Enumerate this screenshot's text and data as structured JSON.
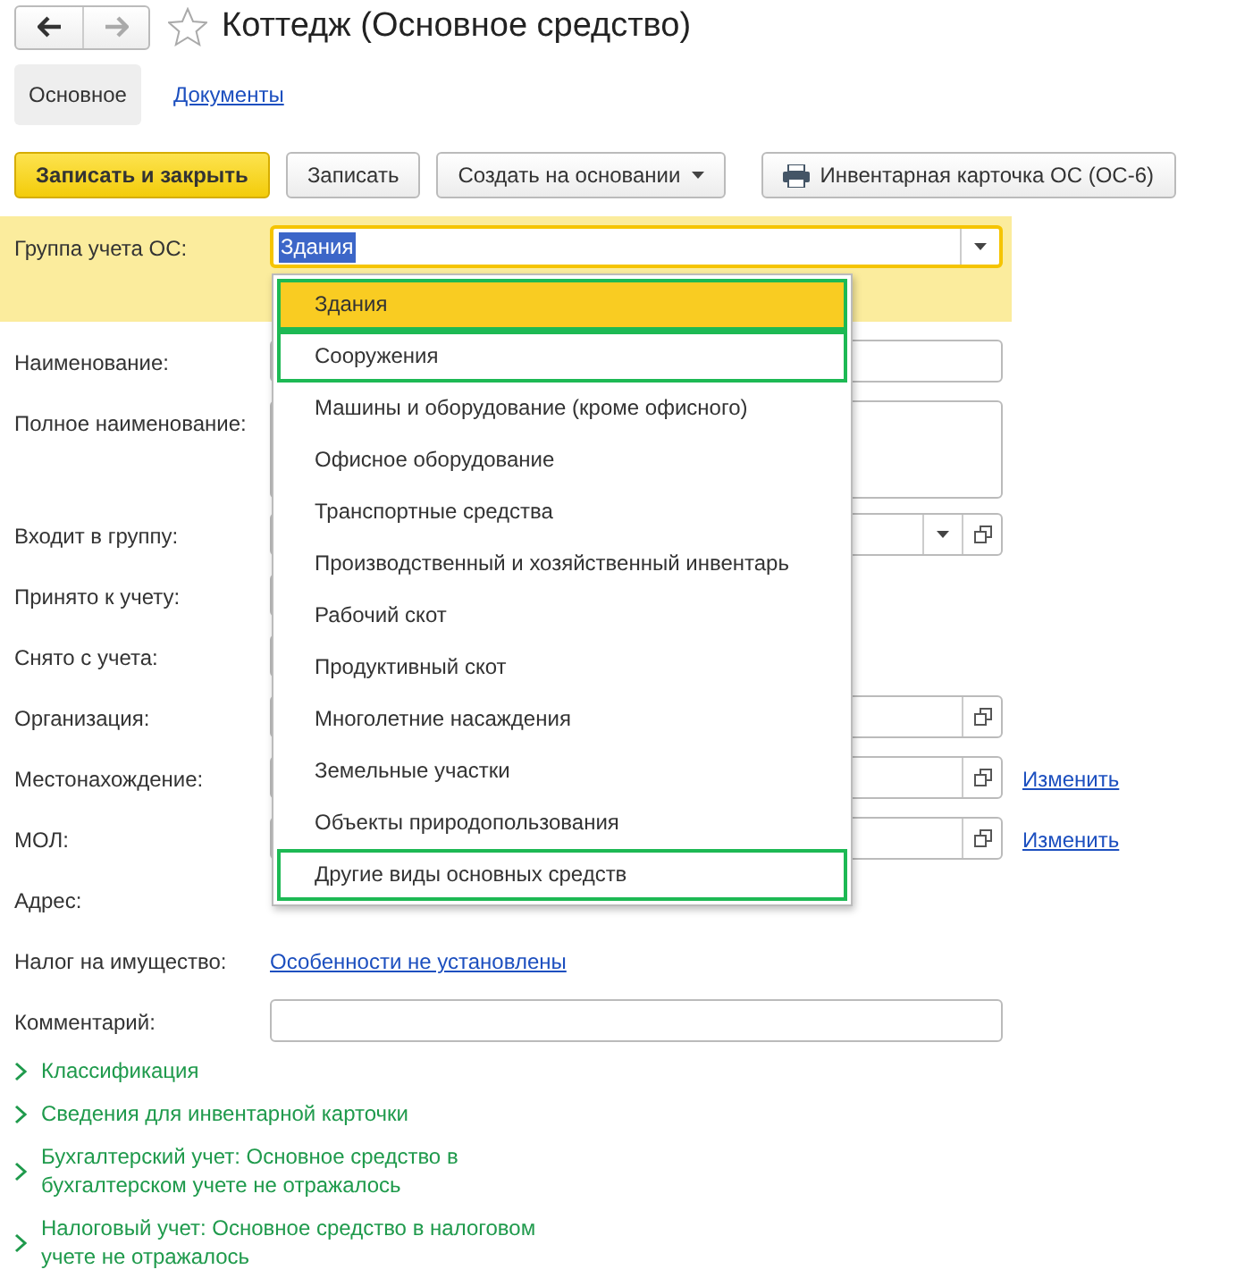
{
  "window": {
    "title": "Коттедж (Основное средство)",
    "favorite": false
  },
  "tabs": [
    {
      "label": "Основное",
      "selected": true
    },
    {
      "label": "Документы",
      "selected": false
    }
  ],
  "toolbar": [
    {
      "label": "Записать и закрыть",
      "kind": "primary"
    },
    {
      "label": "Записать",
      "kind": "plain"
    },
    {
      "label": "Создать на основании",
      "kind": "menu"
    },
    {
      "label": "Инвентарная карточка ОС (ОС-6)",
      "kind": "print"
    }
  ],
  "group_field": {
    "label": "Группа учета ОС:",
    "value": "Здания"
  },
  "dropdown": [
    {
      "label": "Здания",
      "selected": true,
      "highlighted": true
    },
    {
      "label": "Сооружения",
      "selected": false,
      "highlighted": true
    },
    {
      "label": "Машины и оборудование (кроме офисного)",
      "selected": false,
      "highlighted": false
    },
    {
      "label": "Офисное оборудование",
      "selected": false,
      "highlighted": false
    },
    {
      "label": "Транспортные средства",
      "selected": false,
      "highlighted": false
    },
    {
      "label": "Производственный и хозяйственный инвентарь",
      "selected": false,
      "highlighted": false
    },
    {
      "label": "Рабочий скот",
      "selected": false,
      "highlighted": false
    },
    {
      "label": "Продуктивный скот",
      "selected": false,
      "highlighted": false
    },
    {
      "label": "Многолетние насаждения",
      "selected": false,
      "highlighted": false
    },
    {
      "label": "Земельные участки",
      "selected": false,
      "highlighted": false
    },
    {
      "label": "Объекты природопользования",
      "selected": false,
      "highlighted": false
    },
    {
      "label": "Другие виды основных средств",
      "selected": false,
      "highlighted": true
    }
  ],
  "fields": [
    {
      "label": "Наименование:",
      "kind": "input"
    },
    {
      "label": "Полное наименование:",
      "kind": "textarea"
    },
    {
      "label": "Входит в группу:",
      "kind": "select"
    },
    {
      "label": "Принято к учету:",
      "kind": "date"
    },
    {
      "label": "Снято с учета:",
      "kind": "date"
    },
    {
      "label": "Организация:",
      "kind": "ref"
    },
    {
      "label": "Местонахождение:",
      "kind": "ref",
      "action": "Изменить"
    },
    {
      "label": "МОЛ:",
      "kind": "ref",
      "action": "Изменить"
    },
    {
      "label": "Адрес:",
      "kind": "blank"
    },
    {
      "label": "Налог на имущество:",
      "kind": "link",
      "link": "Особенности не установлены"
    },
    {
      "label": "Комментарий:",
      "kind": "input"
    }
  ],
  "sections": [
    {
      "label": "Классификация",
      "expanded": false
    },
    {
      "label": "Сведения для инвентарной карточки",
      "expanded": false
    },
    {
      "label": "Бухгалтерский учет: Основное средство в бухгалтерском учете не отражалось",
      "expanded": false
    },
    {
      "label": "Налоговый учет: Основное средство в налоговом учете не отражалось",
      "expanded": false
    }
  ]
}
